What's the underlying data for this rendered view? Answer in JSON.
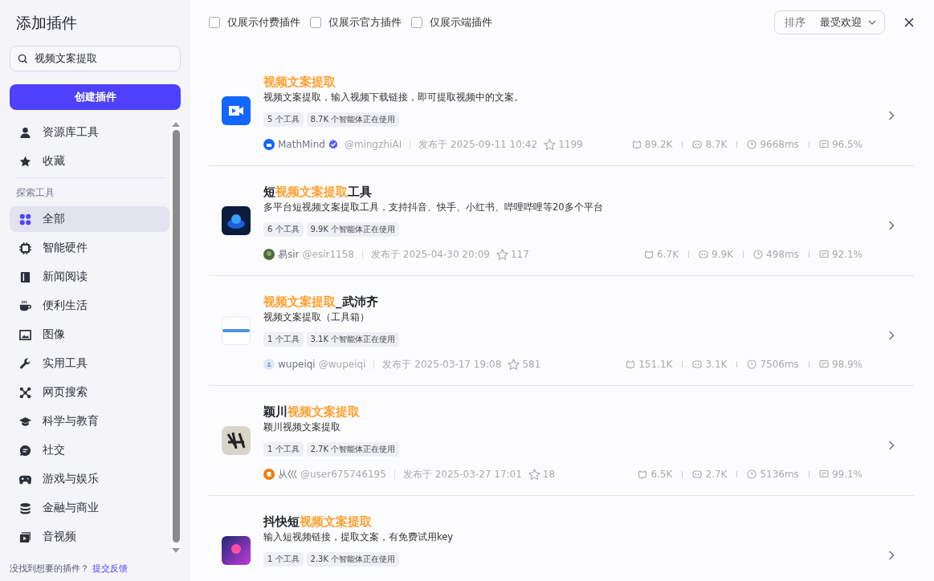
{
  "sidebar": {
    "title": "添加插件",
    "search": {
      "value": "视频文案提取"
    },
    "create_button": "创建插件",
    "top_items": [
      {
        "label": "资源库工具",
        "selected": false
      },
      {
        "label": "收藏",
        "selected": false
      }
    ],
    "section_label": "探索工具",
    "items": [
      {
        "label": "全部",
        "selected": true
      },
      {
        "label": "智能硬件",
        "selected": false
      },
      {
        "label": "新闻阅读",
        "selected": false
      },
      {
        "label": "便利生活",
        "selected": false
      },
      {
        "label": "图像",
        "selected": false
      },
      {
        "label": "实用工具",
        "selected": false
      },
      {
        "label": "网页搜索",
        "selected": false
      },
      {
        "label": "科学与教育",
        "selected": false
      },
      {
        "label": "社交",
        "selected": false
      },
      {
        "label": "游戏与娱乐",
        "selected": false
      },
      {
        "label": "金融与商业",
        "selected": false
      },
      {
        "label": "音视频",
        "selected": false
      }
    ],
    "footer_text": "没找到想要的插件？",
    "footer_link": "提交反馈"
  },
  "filters": [
    {
      "label": "仅展示付费插件",
      "checked": false
    },
    {
      "label": "仅展示官方插件",
      "checked": false
    },
    {
      "label": "仅展示端插件",
      "checked": false
    }
  ],
  "sort": {
    "label": "排序",
    "value": "最受欢迎"
  },
  "plugins": [
    {
      "title": [
        {
          "text": "视频文案提取",
          "match": true
        }
      ],
      "description": "视频文案提取，输入视频下载链接，即可提取视频中的文案。",
      "tags": [
        "5 个工具",
        "8.7K 个智能体正在使用"
      ],
      "author": "MathMind",
      "verified": true,
      "handle": "@mingzhiAI",
      "published": "发布于 2025-09-11 10:42",
      "favorites": "1199",
      "calls": "89.2K",
      "bots": "8.7K",
      "latency": "9668ms",
      "success": "96.5%"
    },
    {
      "title": [
        {
          "text": "短",
          "match": false
        },
        {
          "text": "视频文案提取",
          "match": true
        },
        {
          "text": "工具",
          "match": false
        }
      ],
      "description": "多平台短视频文案提取工具，支持抖音、快手、小红书、哔哩哔哩等20多个平台",
      "tags": [
        "6 个工具",
        "9.9K 个智能体正在使用"
      ],
      "author": "易sir",
      "verified": false,
      "handle": "@esir1158",
      "published": "发布于 2025-04-30 20:09",
      "favorites": "117",
      "calls": "6.7K",
      "bots": "9.9K",
      "latency": "498ms",
      "success": "92.1%"
    },
    {
      "title": [
        {
          "text": "视频文案提取",
          "match": true
        },
        {
          "text": "_武沛齐",
          "match": false
        }
      ],
      "description": "视频文案提取（工具箱）",
      "tags": [
        "1 个工具",
        "3.1K 个智能体正在使用"
      ],
      "author": "wupeiqi",
      "verified": false,
      "handle": "@wupeiqi",
      "published": "发布于 2025-03-17 19:08",
      "favorites": "581",
      "calls": "151.1K",
      "bots": "3.1K",
      "latency": "7506ms",
      "success": "98.9%"
    },
    {
      "title": [
        {
          "text": "颖川",
          "match": false
        },
        {
          "text": "视频文案提取",
          "match": true
        }
      ],
      "description": "颖川视频文案提取",
      "tags": [
        "1 个工具",
        "2.7K 个智能体正在使用"
      ],
      "author": "从巛",
      "verified": false,
      "handle": "@user675746195",
      "published": "发布于 2025-03-27 17:01",
      "favorites": "18",
      "calls": "6.5K",
      "bots": "2.7K",
      "latency": "5136ms",
      "success": "99.1%"
    },
    {
      "title": [
        {
          "text": "抖快短",
          "match": false
        },
        {
          "text": "视频文案提取",
          "match": true
        }
      ],
      "description": "输入短视频链接，提取文案，有免费试用key",
      "tags": [
        "1 个工具",
        "2.3K 个智能体正在使用"
      ]
    }
  ]
}
